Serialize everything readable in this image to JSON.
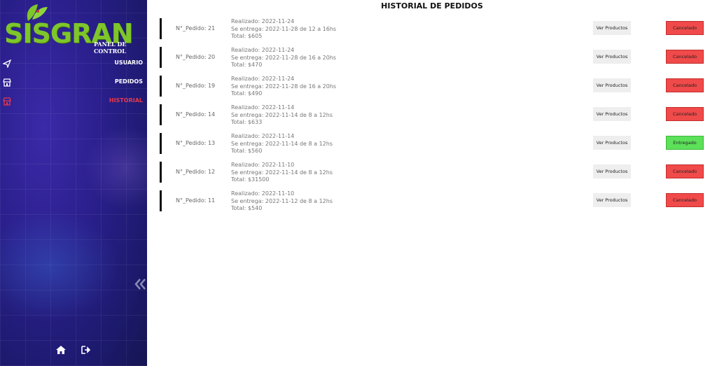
{
  "sidebar": {
    "logo_text": "SISGRAN",
    "logo_subtitle": "PANEL DE CONTROL",
    "items": [
      {
        "label": "USUARIO",
        "icon": "paper-plane-icon",
        "active": false
      },
      {
        "label": "PEDIDOS",
        "icon": "store-icon",
        "active": false
      },
      {
        "label": "HISTORIAL",
        "icon": "store-icon",
        "active": true
      }
    ],
    "bottom_icons": [
      "home-icon",
      "logout-icon"
    ],
    "collapse_icon": "double-chevron-left-icon"
  },
  "main": {
    "title": "HISTORIAL DE PEDIDOS",
    "view_button_label": "Ver Productos",
    "orders": [
      {
        "number": "N°_Pedido: 21",
        "realizado": "Realizado: 2022-11-24",
        "entrega": "Se entrega: 2022-11-28 de 12 a 16hs",
        "total": "Total: $605",
        "status": "Cancelado"
      },
      {
        "number": "N°_Pedido: 20",
        "realizado": "Realizado: 2022-11-24",
        "entrega": "Se entrega: 2022-11-28 de 16 a 20hs",
        "total": "Total: $470",
        "status": "Cancelado"
      },
      {
        "number": "N°_Pedido: 19",
        "realizado": "Realizado: 2022-11-24",
        "entrega": "Se entrega: 2022-11-28 de 16 a 20hs",
        "total": "Total: $490",
        "status": "Cancelado"
      },
      {
        "number": "N°_Pedido: 14",
        "realizado": "Realizado: 2022-11-14",
        "entrega": "Se entrega: 2022-11-14 de 8 a 12hs",
        "total": "Total: $633",
        "status": "Cancelado"
      },
      {
        "number": "N°_Pedido: 13",
        "realizado": "Realizado: 2022-11-14",
        "entrega": "Se entrega: 2022-11-14 de 8 a 12hs",
        "total": "Total: $560",
        "status": "Entregado"
      },
      {
        "number": "N°_Pedido: 12",
        "realizado": "Realizado: 2022-11-10",
        "entrega": "Se entrega: 2022-11-14 de 8 a 12hs",
        "total": "Total: $31500",
        "status": "Cancelado"
      },
      {
        "number": "N°_Pedido: 11",
        "realizado": "Realizado: 2022-11-10",
        "entrega": "Se entrega: 2022-11-12 de 8 a 12hs",
        "total": "Total: $540",
        "status": "Cancelado"
      }
    ]
  },
  "colors": {
    "brand_green": "#7ec62a",
    "active_nav": "#e8384a",
    "cancelled": "#f04a4a",
    "delivered": "#5de05a"
  }
}
